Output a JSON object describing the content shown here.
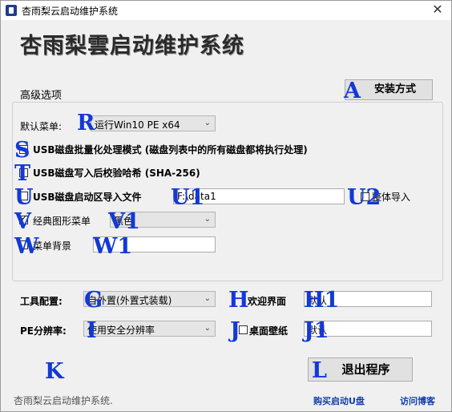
{
  "window": {
    "title": "杏雨梨云启动维护系统",
    "close_glyph": "✕"
  },
  "banner": {
    "text": "杏雨梨雲启动维护系统"
  },
  "advanced": {
    "label": "高级选项",
    "install_button": "安装方式"
  },
  "default_menu": {
    "label": "默认菜单:",
    "value": "运行Win10 PE x64"
  },
  "options": {
    "batch": {
      "label": "USB磁盘批量化处理模式 (磁盘列表中的所有磁盘都将执行处理)",
      "checked": false
    },
    "hash": {
      "label": "USB磁盘写入后校验哈希 (SHA-256)",
      "checked": false
    },
    "bootfile": {
      "label": "USB磁盘启动区导入文件",
      "checked": false,
      "path": "F:\\data1",
      "whole_label": "整体导入",
      "whole_checked": false
    },
    "classic": {
      "label": "经典图形菜单",
      "checked": true,
      "color": "黑色"
    },
    "bg": {
      "label": "菜单背景",
      "checked": false,
      "value": ""
    }
  },
  "tools": {
    "label": "工具配置:",
    "value": "自外置(外置式装载)",
    "welcome_label": "欢迎界面",
    "welcome_value": "默认"
  },
  "pe_res": {
    "label": "PE分辨率:",
    "value": "使用安全分辨率",
    "wallpaper_label": "桌面壁纸",
    "wallpaper_value": "默认"
  },
  "exit_button": "退出程序",
  "footer": {
    "text": "杏雨梨云启动维护系统.",
    "buy_link": "购买启动U盘",
    "blog_link": "访问博客"
  },
  "markers": [
    "A",
    "R",
    "S",
    "T",
    "U",
    "U1",
    "U2",
    "V",
    "V1",
    "W",
    "W1",
    "G",
    "H",
    "H1",
    "I",
    "J",
    "J1",
    "K",
    "L"
  ]
}
